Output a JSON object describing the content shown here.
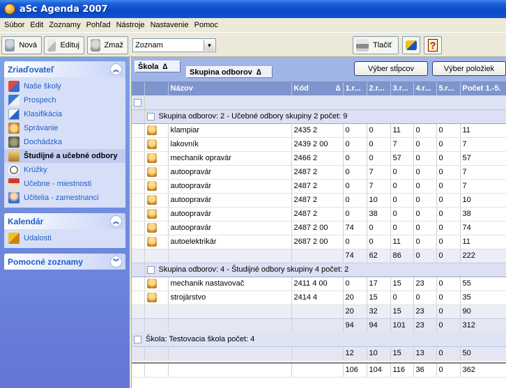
{
  "window": {
    "title": "aSc Agenda 2007"
  },
  "menu": [
    "Súbor",
    "Edit",
    "Zoznamy",
    "Pohľad",
    "Nástroje",
    "Nastavenie",
    "Pomoc"
  ],
  "toolbar": {
    "new_label": "Nová",
    "edit_label": "Edituj",
    "delete_label": "Zmaž",
    "view_select_value": "Zoznam",
    "print_label": "Tlačiť"
  },
  "sidebar": {
    "zriadovatel": {
      "title": "Zriaďovateľ",
      "items": [
        "Naše školy",
        "Prospech",
        "Klasifikácia",
        "Správanie",
        "Dochádzka",
        "Študijné a učebné odbory",
        "Krúžky",
        "Učebne - miestnosti",
        "Učitelia - zamestnanci"
      ]
    },
    "kalendar": {
      "title": "Kalendár",
      "items": [
        "Udalosti"
      ]
    },
    "pomocne": {
      "title": "Pomocné zoznamy"
    }
  },
  "grouping": {
    "level1": "Škola",
    "level2": "Skupina odborov",
    "sort_glyph": "∆",
    "btn_columns": "Výber stĺpcov",
    "btn_items": "Výber položiek"
  },
  "columns": [
    "Názov",
    "Kód",
    "1.r...",
    "2.r...",
    "3.r...",
    "4.r...",
    "5.r...",
    "Počet 1.-5."
  ],
  "kod_sort_glyph": "∆",
  "groups": [
    {
      "label": "Skupina odborov:  2 - Učebné odbory skupiny 2  počet: 9",
      "rows": [
        [
          "klampiar",
          "2435 2",
          "0",
          "0",
          "11",
          "0",
          "0",
          "11"
        ],
        [
          "lakovník",
          "2439 2 00",
          "0",
          "0",
          "7",
          "0",
          "0",
          "7"
        ],
        [
          "mechanik opravár",
          "2466 2",
          "0",
          "0",
          "57",
          "0",
          "0",
          "57"
        ],
        [
          "autoopravár",
          "2487 2",
          "0",
          "7",
          "0",
          "0",
          "0",
          "7"
        ],
        [
          "autoopravár",
          "2487 2",
          "0",
          "7",
          "0",
          "0",
          "0",
          "7"
        ],
        [
          "autoopravár",
          "2487 2",
          "0",
          "10",
          "0",
          "0",
          "0",
          "10"
        ],
        [
          "autoopravár",
          "2487 2",
          "0",
          "38",
          "0",
          "0",
          "0",
          "38"
        ],
        [
          "autoopravár",
          "2487 2 00",
          "74",
          "0",
          "0",
          "0",
          "0",
          "74"
        ],
        [
          "autoelektrikár",
          "2687 2 00",
          "0",
          "0",
          "11",
          "0",
          "0",
          "11"
        ]
      ],
      "sum": [
        "74",
        "62",
        "86",
        "0",
        "0",
        "222"
      ]
    },
    {
      "label": "Skupina odborov:  4 - Študijné odbory skupiny 4  počet: 2",
      "rows": [
        [
          "mechanik nastavovač",
          "2411 4 00",
          "0",
          "17",
          "15",
          "23",
          "0",
          "55"
        ],
        [
          "strojárstvo",
          "2414 4",
          "20",
          "15",
          "0",
          "0",
          "0",
          "35"
        ]
      ],
      "sum": [
        "20",
        "32",
        "15",
        "23",
        "0",
        "90"
      ]
    }
  ],
  "school_sum": [
    "94",
    "94",
    "101",
    "23",
    "0",
    "312"
  ],
  "school2": {
    "label": "Škola:  Testovacia škola  počet: 4",
    "sum": [
      "12",
      "10",
      "15",
      "13",
      "0",
      "50"
    ]
  },
  "grand_total": [
    "106",
    "104",
    "116",
    "36",
    "0",
    "362"
  ]
}
